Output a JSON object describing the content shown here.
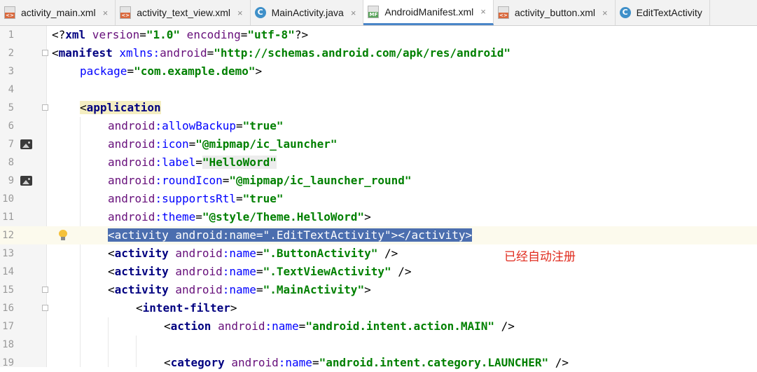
{
  "tabs": [
    {
      "label": "activity_main.xml",
      "icon": "xml-file-icon",
      "active": false,
      "closable": true
    },
    {
      "label": "activity_text_view.xml",
      "icon": "xml-file-icon",
      "active": false,
      "closable": true
    },
    {
      "label": "MainActivity.java",
      "icon": "java-class-icon",
      "active": false,
      "closable": true
    },
    {
      "label": "AndroidManifest.xml",
      "icon": "manifest-file-icon",
      "active": true,
      "closable": true
    },
    {
      "label": "activity_button.xml",
      "icon": "xml-file-icon",
      "active": false,
      "closable": true
    },
    {
      "label": "EditTextActivity",
      "icon": "java-class-icon",
      "active": false,
      "closable": false
    }
  ],
  "close_glyph": "×",
  "java_icon_letter": "C",
  "editor": {
    "line_numbers": [
      "1",
      "2",
      "3",
      "4",
      "5",
      "6",
      "7",
      "8",
      "9",
      "10",
      "11",
      "12",
      "13",
      "14",
      "15",
      "16",
      "17",
      "18",
      "19"
    ],
    "annotation": "已经自动注册",
    "lines": {
      "l1": {
        "pre": "<?",
        "tag": "xml",
        "a1": " version",
        "eq1": "=",
        "v1": "\"1.0\"",
        "a2": " encoding",
        "eq2": "=",
        "v2": "\"utf-8\"",
        "post": "?>"
      },
      "l2": {
        "pre": "<",
        "tag": "manifest",
        "ans": " xmlns:",
        "an": "android",
        "eq": "=",
        "v": "\"http://schemas.android.com/apk/res/android\""
      },
      "l3": {
        "a": "package",
        "eq": "=",
        "v": "\"com.example.demo\"",
        "post": ">"
      },
      "l5": {
        "pre": "<",
        "tag": "application"
      },
      "l6": {
        "ns": "android",
        "attr": ":allowBackup",
        "eq": "=",
        "v": "\"true\""
      },
      "l7": {
        "ns": "android",
        "attr": ":icon",
        "eq": "=",
        "v": "\"@mipmap/ic_launcher\""
      },
      "l8": {
        "ns": "android",
        "attr": ":label",
        "eq": "=",
        "v": "\"HelloWord\""
      },
      "l9": {
        "ns": "android",
        "attr": ":roundIcon",
        "eq": "=",
        "v": "\"@mipmap/ic_launcher_round\""
      },
      "l10": {
        "ns": "android",
        "attr": ":supportsRtl",
        "eq": "=",
        "v": "\"true\""
      },
      "l11": {
        "ns": "android",
        "attr": ":theme",
        "eq": "=",
        "v": "\"@style/Theme.HelloWord\"",
        "post": ">"
      },
      "l12": {
        "text": "<activity android:name=\".EditTextActivity\"></activity>"
      },
      "l13": {
        "pre": "<",
        "tag": "activity",
        "ns": " android",
        "attr": ":name",
        "eq": "=",
        "v": "\".ButtonActivity\"",
        "post": " />"
      },
      "l14": {
        "pre": "<",
        "tag": "activity",
        "ns": " android",
        "attr": ":name",
        "eq": "=",
        "v": "\".TextViewActivity\"",
        "post": " />"
      },
      "l15": {
        "pre": "<",
        "tag": "activity",
        "ns": " android",
        "attr": ":name",
        "eq": "=",
        "v": "\".MainActivity\"",
        "post": ">"
      },
      "l16": {
        "pre": "<",
        "tag": "intent-filter",
        "post": ">"
      },
      "l17": {
        "pre": "<",
        "tag": "action",
        "ns": " android",
        "attr": ":name",
        "eq": "=",
        "v": "\"android.intent.action.MAIN\"",
        "post": " />"
      },
      "l19": {
        "pre": "<",
        "tag": "category",
        "ns": " android",
        "attr": ":name",
        "eq": "=",
        "v": "\"android.intent.category.LAUNCHER\"",
        "post": " />"
      }
    },
    "colors": {
      "tag": "#000080",
      "attribute": "#660e7a",
      "namespace_attr": "#0000ff",
      "value": "#008000",
      "selection": "#4b6eaf",
      "annotation": "#e02b1e",
      "active_tab_underline": "#4a86c8"
    }
  }
}
